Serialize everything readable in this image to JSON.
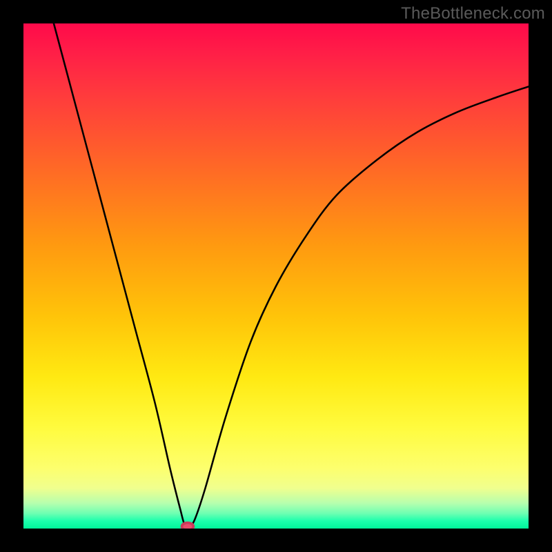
{
  "watermark": "TheBottleneck.com",
  "chart_data": {
    "type": "line",
    "title": "",
    "xlabel": "",
    "ylabel": "",
    "xlim": [
      0,
      100
    ],
    "ylim": [
      0,
      100
    ],
    "curve": {
      "name": "bottleneck-curve",
      "points": [
        {
          "x": 6,
          "y": 100
        },
        {
          "x": 10,
          "y": 85
        },
        {
          "x": 14,
          "y": 70
        },
        {
          "x": 18,
          "y": 55
        },
        {
          "x": 22,
          "y": 40
        },
        {
          "x": 26,
          "y": 25
        },
        {
          "x": 29,
          "y": 12
        },
        {
          "x": 31,
          "y": 4
        },
        {
          "x": 32,
          "y": 0.5
        },
        {
          "x": 33,
          "y": 0.5
        },
        {
          "x": 34,
          "y": 2
        },
        {
          "x": 36,
          "y": 8
        },
        {
          "x": 40,
          "y": 22
        },
        {
          "x": 45,
          "y": 37
        },
        {
          "x": 50,
          "y": 48
        },
        {
          "x": 56,
          "y": 58
        },
        {
          "x": 62,
          "y": 66
        },
        {
          "x": 70,
          "y": 73
        },
        {
          "x": 78,
          "y": 78.5
        },
        {
          "x": 86,
          "y": 82.5
        },
        {
          "x": 94,
          "y": 85.5
        },
        {
          "x": 100,
          "y": 87.5
        }
      ]
    },
    "marker": {
      "x": 32.5,
      "y": 0.4
    },
    "background_gradient": {
      "type": "vertical",
      "stops": [
        {
          "pos": 0,
          "color": "#ff0a4a"
        },
        {
          "pos": 50,
          "color": "#ffb80e"
        },
        {
          "pos": 82,
          "color": "#fffb3e"
        },
        {
          "pos": 100,
          "color": "#00f59a"
        }
      ]
    }
  }
}
